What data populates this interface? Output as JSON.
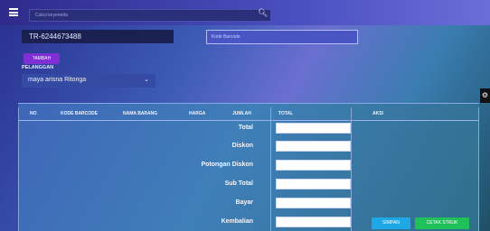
{
  "topbar": {
    "search_placeholder": "Cukui keyeneda"
  },
  "transaction": {
    "number": "TR-6244673488",
    "barcode_placeholder": "Kode Barcode",
    "add_button_label": "TAMBAH"
  },
  "customer": {
    "label": "PELANGGAN",
    "selected": "maya arisna Ritonga"
  },
  "table": {
    "headers": [
      "NO",
      "KODE BARCODE",
      "NAMA BARANG",
      "HARGA",
      "JUMLAH",
      "TOTAL",
      "AKSI"
    ]
  },
  "summary": {
    "rows": [
      {
        "label": "Total"
      },
      {
        "label": "Diskon"
      },
      {
        "label": "Potongan Diskon"
      },
      {
        "label": "Sub Total"
      },
      {
        "label": "Bayar"
      },
      {
        "label": "Kembalian"
      }
    ]
  },
  "actions": {
    "save_label": "SIMPAN",
    "print_label": "CETAK STRUK"
  }
}
